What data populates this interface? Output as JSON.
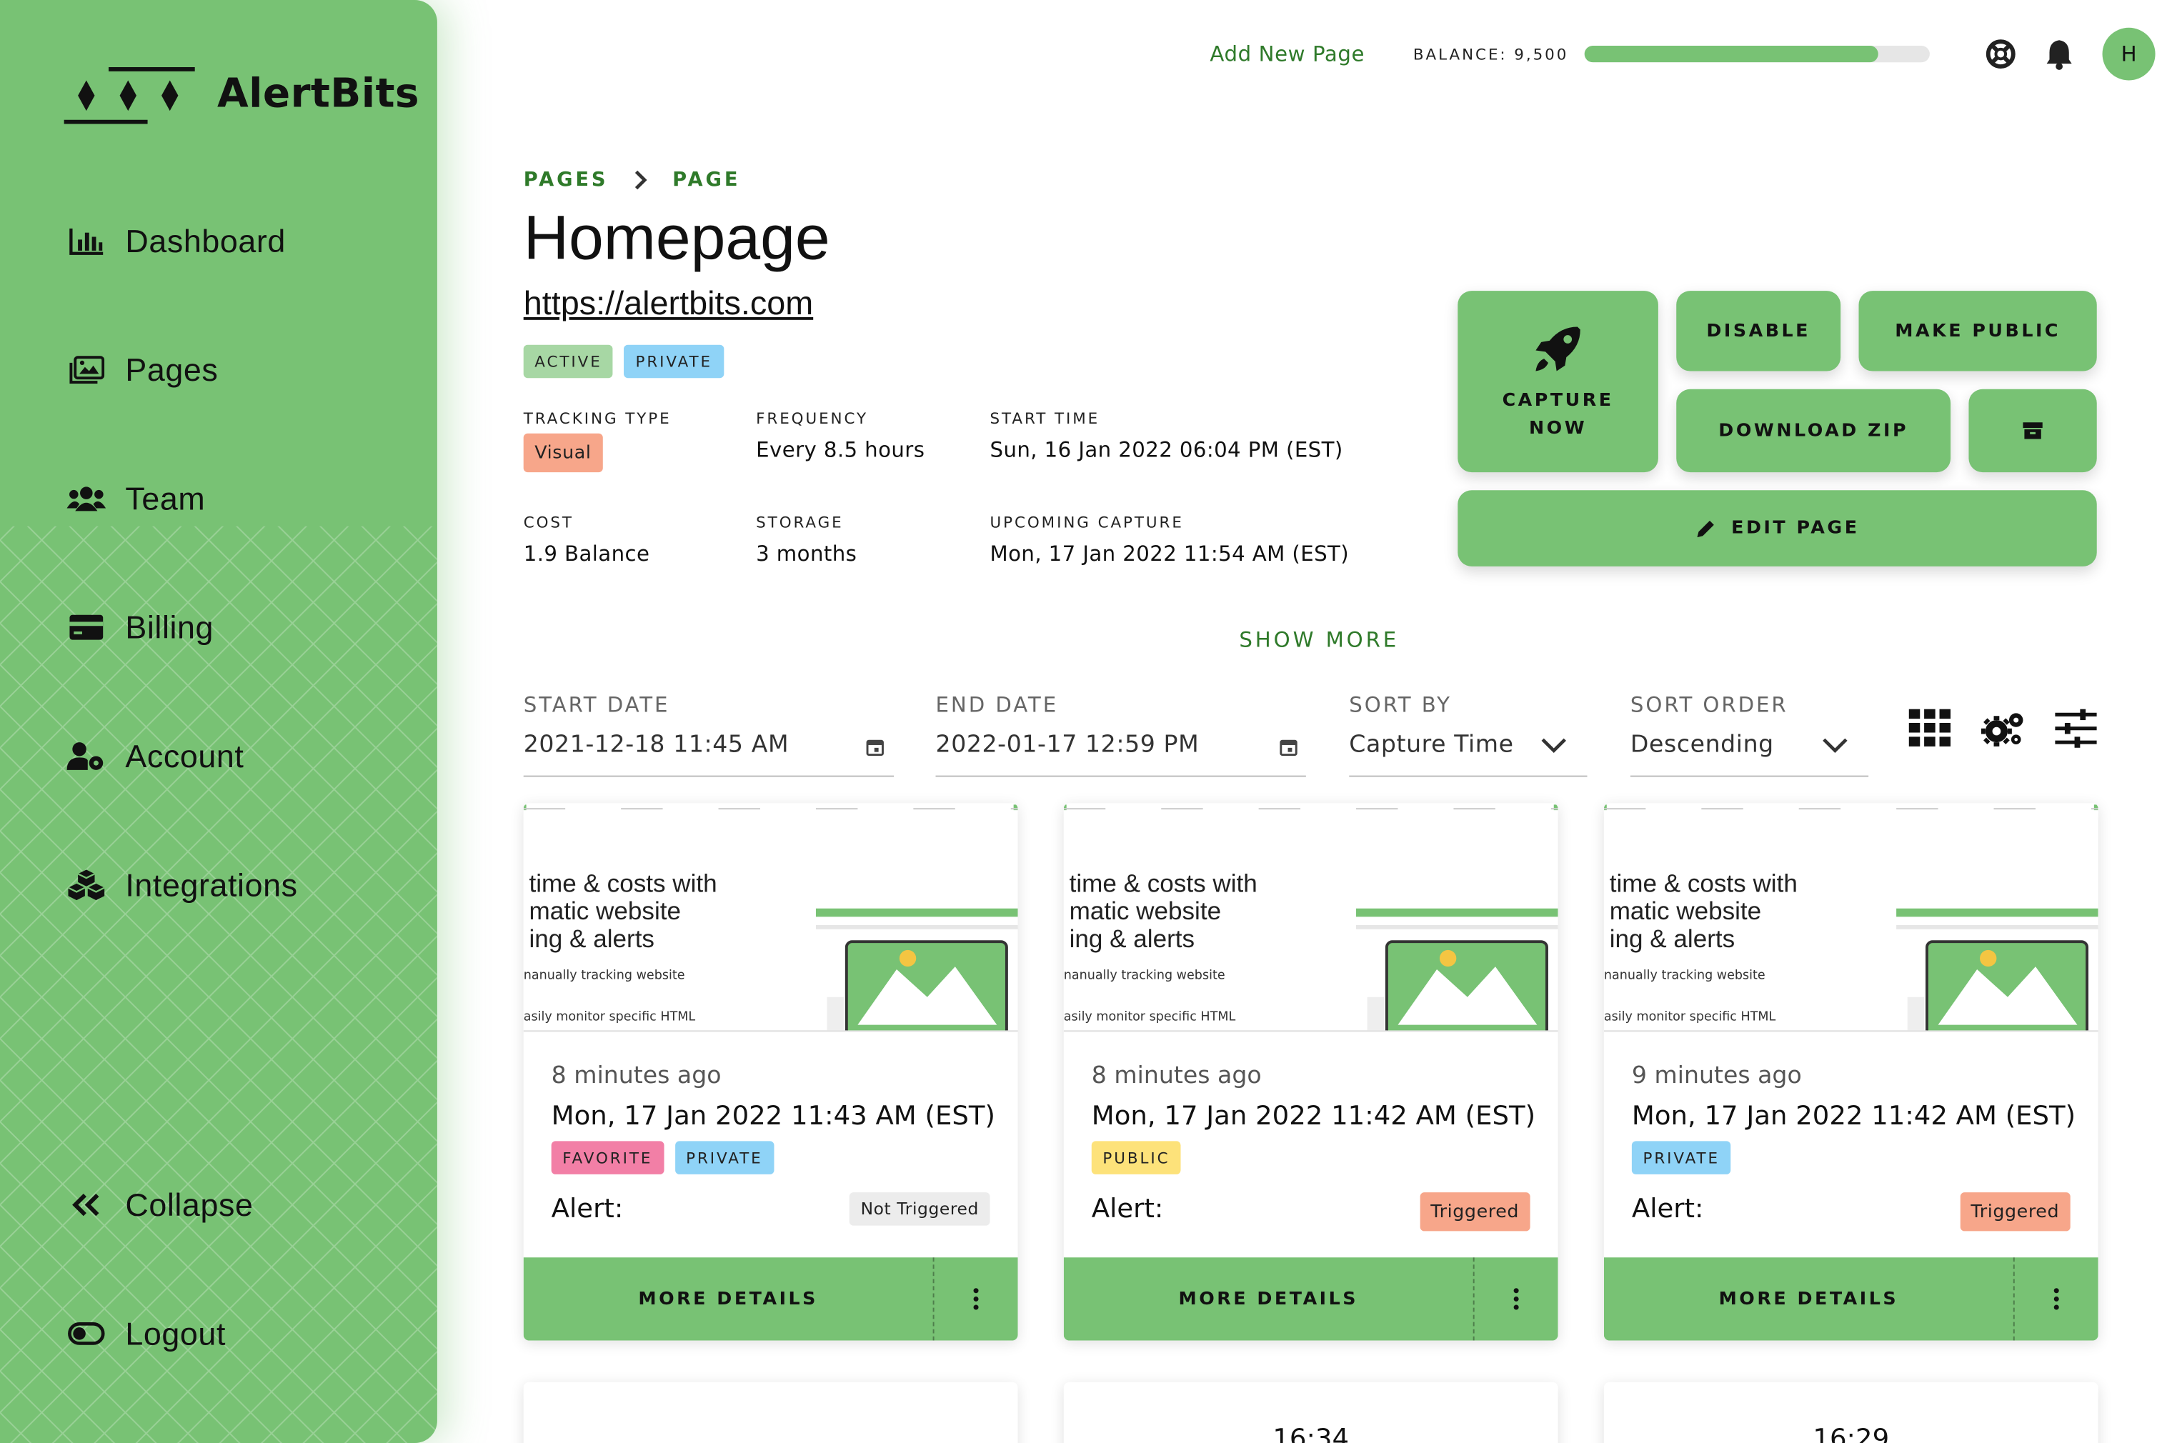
{
  "sidebar": {
    "brand": "AlertBits",
    "items": [
      {
        "label": "Dashboard",
        "icon": "chart-bar-icon"
      },
      {
        "label": "Pages",
        "icon": "images-icon"
      },
      {
        "label": "Team",
        "icon": "users-icon"
      },
      {
        "label": "Billing",
        "icon": "credit-card-icon"
      },
      {
        "label": "Account",
        "icon": "user-cog-icon"
      },
      {
        "label": "Integrations",
        "icon": "cubes-icon"
      }
    ],
    "collapse_label": "Collapse",
    "logout_label": "Logout"
  },
  "header": {
    "add_new_page": "Add New Page",
    "balance": "BALANCE: 9,500",
    "balance_fill": 0.85,
    "avatar_initial": "H"
  },
  "breadcrumb": {
    "first": "PAGES",
    "second": "PAGE"
  },
  "page": {
    "title": "Homepage",
    "url": "https://alertbits.com",
    "status_chip": "ACTIVE",
    "visibility_chip": "PRIVATE"
  },
  "meta": {
    "tracking_type_label": "TRACKING TYPE",
    "tracking_type_value": "Visual",
    "frequency_label": "FREQUENCY",
    "frequency_value": "Every 8.5 hours",
    "start_time_label": "START TIME",
    "start_time_value": "Sun, 16 Jan 2022 06:04 PM (EST)",
    "cost_label": "COST",
    "cost_value": "1.9 Balance",
    "storage_label": "STORAGE",
    "storage_value": "3 months",
    "upcoming_label": "UPCOMING CAPTURE",
    "upcoming_value": "Mon, 17 Jan 2022 11:54 AM (EST)"
  },
  "actions": {
    "capture_line1": "CAPTURE",
    "capture_line2": "NOW",
    "disable": "DISABLE",
    "make_public": "MAKE PUBLIC",
    "download_zip": "DOWNLOAD ZIP",
    "edit_page": "EDIT PAGE"
  },
  "show_more": "SHOW MORE",
  "filters": {
    "start_label": "START DATE",
    "start_value": "2021-12-18 11:45 AM",
    "end_label": "END DATE",
    "end_value": "2022-01-17 12:59 PM",
    "sort_by_label": "SORT BY",
    "sort_by_value": "Capture Time",
    "sort_order_label": "SORT ORDER",
    "sort_order_value": "Descending"
  },
  "thumbnail": {
    "headline": "time & costs with\nmatic website\ning & alerts",
    "line1": "nanually tracking website",
    "line2": "asily monitor specific HTML"
  },
  "cards": [
    {
      "ago": "8 minutes ago",
      "date": "Mon, 17 Jan 2022 11:43 AM (EST)",
      "chips": [
        "FAVORITE",
        "PRIVATE"
      ],
      "alert_label": "Alert:",
      "status": "Not Triggered",
      "more": "MORE DETAILS"
    },
    {
      "ago": "8 minutes ago",
      "date": "Mon, 17 Jan 2022 11:42 AM (EST)",
      "chips": [
        "PUBLIC"
      ],
      "alert_label": "Alert:",
      "status": "Triggered",
      "more": "MORE DETAILS"
    },
    {
      "ago": "9 minutes ago",
      "date": "Mon, 17 Jan 2022 11:42 AM (EST)",
      "chips": [
        "PRIVATE"
      ],
      "alert_label": "Alert:",
      "status": "Triggered",
      "more": "MORE DETAILS"
    }
  ],
  "partial_cards": [
    {
      "clock": ""
    },
    {
      "clock": "16:34"
    },
    {
      "clock": "16:29"
    }
  ],
  "colors": {
    "accent": "#78c274",
    "link": "#2f7a2a",
    "favorite": "#f27fa6",
    "private": "#8fd3f7",
    "public": "#fde27a",
    "triggered": "#f7a68a"
  }
}
